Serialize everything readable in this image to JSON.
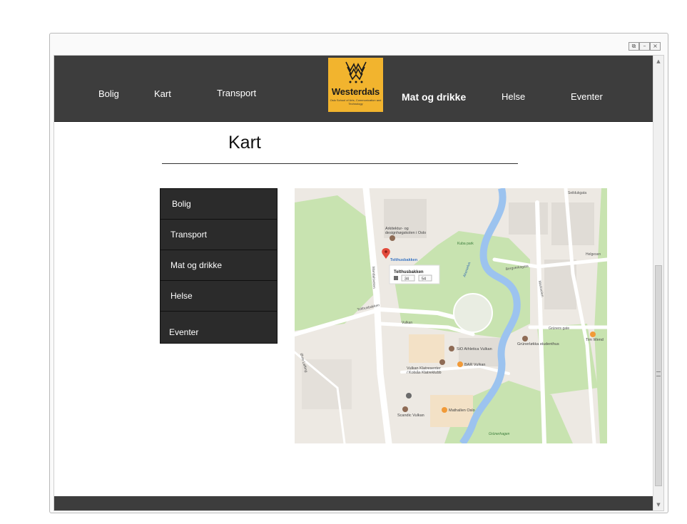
{
  "nav": {
    "left": [
      "Bolig",
      "Kart",
      "Transport"
    ],
    "right": [
      "Mat og drikke",
      "Helse",
      "Eventer"
    ]
  },
  "logo": {
    "name": "Westerdals",
    "tagline": "Oslo School of Arts, Communication and Technology"
  },
  "page": {
    "title": "Kart"
  },
  "side_menu": [
    "Bolig",
    "Transport",
    "Mat og drikke",
    "Helse",
    "Eventer"
  ],
  "map": {
    "labels": {
      "arch": "Arkitektur- og designhøgskolen i Oslo",
      "telthus_pin": "Telthusbakken",
      "popup_title": "Telthusbakken",
      "bus1": "34",
      "bus2": "54",
      "kubapark": "Kuba park",
      "akerselva": "Akerselva",
      "bergverks": "Bergverksgata",
      "markveien": "Markveien",
      "seilduks": "Seildukgata",
      "helgesen": "Helgesen",
      "gruners": "Grüners gate",
      "timwend": "Tim Wend",
      "telthusbakken_st": "Telthusbakken",
      "maridalsveien": "Maridalsveien",
      "vulkan_st": "Vulkan",
      "sio": "SiO Athletica Vulkan",
      "grunerlokka": "Grünerløkka studenthus",
      "bar": "BAR Vulkan",
      "klatre": "Vulkan Klatresenter / Kolsås Klatreklubb",
      "mathallen": "Mathallen Oslo",
      "scandic": "Scandic Vulkan",
      "grunerhagen": "Grünerhagen",
      "lofting": "Øvre Løfting"
    },
    "colors": {
      "park": "#c8e3b0",
      "river": "#9cc3ef",
      "road": "#ffffff",
      "land": "#ede9e3"
    }
  },
  "window": {
    "controls": [
      "restore-icon",
      "minimize-icon",
      "close-icon"
    ]
  },
  "colors": {
    "header": "#3d3d3d",
    "menu": "#2b2b2b",
    "logo_bg": "#f2b42e"
  }
}
